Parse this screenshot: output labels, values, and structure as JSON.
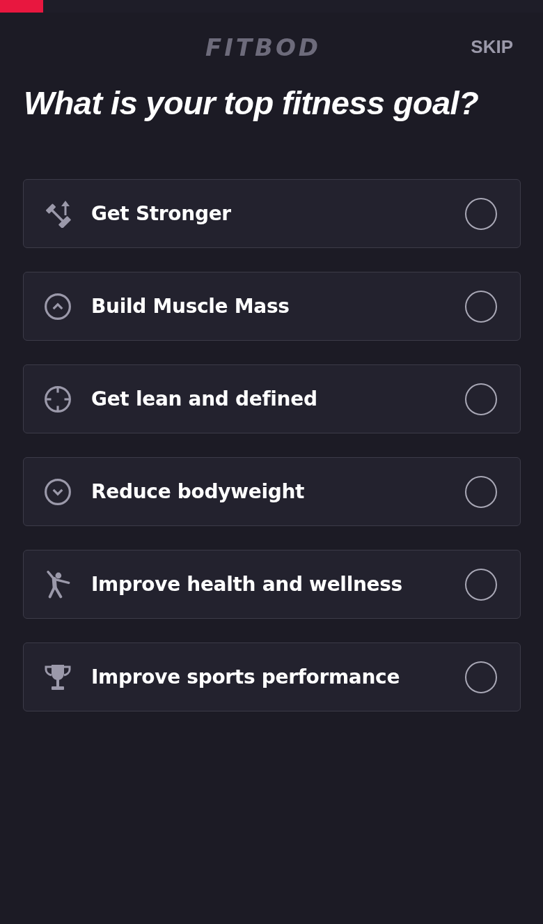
{
  "progress": {
    "level": 0.08
  },
  "header": {
    "logo": "FITBOD",
    "skip": "SKIP"
  },
  "title": "What is your top fitness goal?",
  "options": [
    {
      "label": "Get Stronger",
      "selected": false
    },
    {
      "label": "Build Muscle Mass",
      "selected": false
    },
    {
      "label": "Get lean and defined",
      "selected": false
    },
    {
      "label": "Reduce bodyweight",
      "selected": false
    },
    {
      "label": "Improve health and wellness",
      "selected": false
    },
    {
      "label": "Improve sports performance",
      "selected": false
    }
  ]
}
